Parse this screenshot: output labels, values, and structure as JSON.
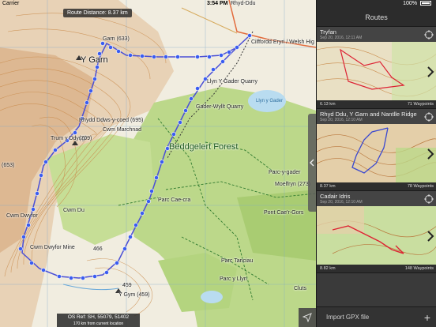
{
  "status_bar": {
    "carrier": "Carrier",
    "clock": "3:54 PM",
    "battery": "100%"
  },
  "map": {
    "route_distance": "Route Distance: 8.37 km",
    "os_ref": "OS Ref: SH, 55079, 51402",
    "os_ref_sub": "170 km from current location",
    "labels": {
      "rhyd_ddu": "Rhyd-Ddu",
      "y_garn_big": "Y Garn",
      "garn_633": "Garn (633)",
      "llyn_y_gader": "Llyn Y Gader Quarry",
      "gader_wyllt": "Gader-Wyllt Quarry",
      "llyn_y_gader_water": "Llyn y Gader",
      "rhydd_ddwsy": "Rhydd Ddws-y-coed (695)",
      "cwm_marchnad": "Cwm Marchnad",
      "trum_y_ddysgl": "Trum y Ddysgl",
      "trum_709": "(709)",
      "beddgelert_forest": "Beddgelert Forest",
      "parc_y_gader": "Parc-y-gader",
      "moelfryn": "Moelfryn (273)",
      "cwm_du": "Cwm Du",
      "cwm_dwyfor": "Cwm Dwyfor",
      "parc_cae_cra": "Parc Cae-cra",
      "pont_cae_gors": "Pont Cae'r-Gors",
      "cwm_dwyfor_mine": "Cwm Dwyfor Mine",
      "parc_tanciau": "Parc Tanciau",
      "parc_y_llyn": "Parc y Llyn",
      "y_gym": "Y Gym (459)",
      "h459": "459",
      "h466": "466",
      "h653": "(653)",
      "cluts": "Cluts",
      "welsh_hig": "Cilffordd Eryri / Welsh Hig"
    }
  },
  "panel": {
    "title": "Routes",
    "routes": [
      {
        "name": "Tryfan",
        "date": "Sep 20, 2016, 12:11 AM",
        "distance": "6.13 km",
        "waypoints": "71 Waypoints"
      },
      {
        "name": "Rhyd Ddu, Y Garn and Nantlle Ridge",
        "date": "Sep 20, 2016, 12:10 AM",
        "distance": "8.37 km",
        "waypoints": "78 Waypoints"
      },
      {
        "name": "Cadair Idris",
        "date": "Sep 20, 2016, 12:10 AM",
        "distance": "8.82 km",
        "waypoints": "148 Waypoints"
      }
    ],
    "import_label": "Import GPX file",
    "import_plus": "+"
  },
  "colors": {
    "forest": "#bcd88a",
    "forest_dark": "#a9cc72",
    "contour": "#c98a4a",
    "route": "#4a4fd6",
    "waypoint": "#3a5cf0",
    "panel_bg": "#3a3a3a"
  }
}
